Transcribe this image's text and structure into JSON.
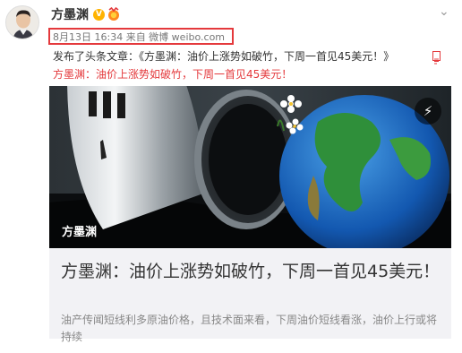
{
  "post": {
    "author": "方墨渊",
    "verified_icon": "verified-v-icon",
    "medal_icon": "fan-medal-icon",
    "menu_icon": "chevron-down-icon",
    "meta": "8月13日 16:34 来自 微博 weibo.com",
    "line1": "发布了头条文章：《方墨渊：油价上涨势如破竹，下周一首见45美元！》",
    "line1_icon": "article-icon",
    "line2": "方墨渊：油价上涨势如破竹，下周一首见45美元！"
  },
  "card": {
    "image_caption": "方墨渊",
    "badge_icon": "lightning-icon",
    "title": "方墨渊：油价上涨势如破竹，下周一首见45美元！",
    "description": "油产传闻短线利多原油价格，且技术面来看，下周油价短线看涨，油价上行或将持续"
  },
  "colors": {
    "highlight": "#e4393c",
    "card_bg": "#f2f2f5"
  }
}
